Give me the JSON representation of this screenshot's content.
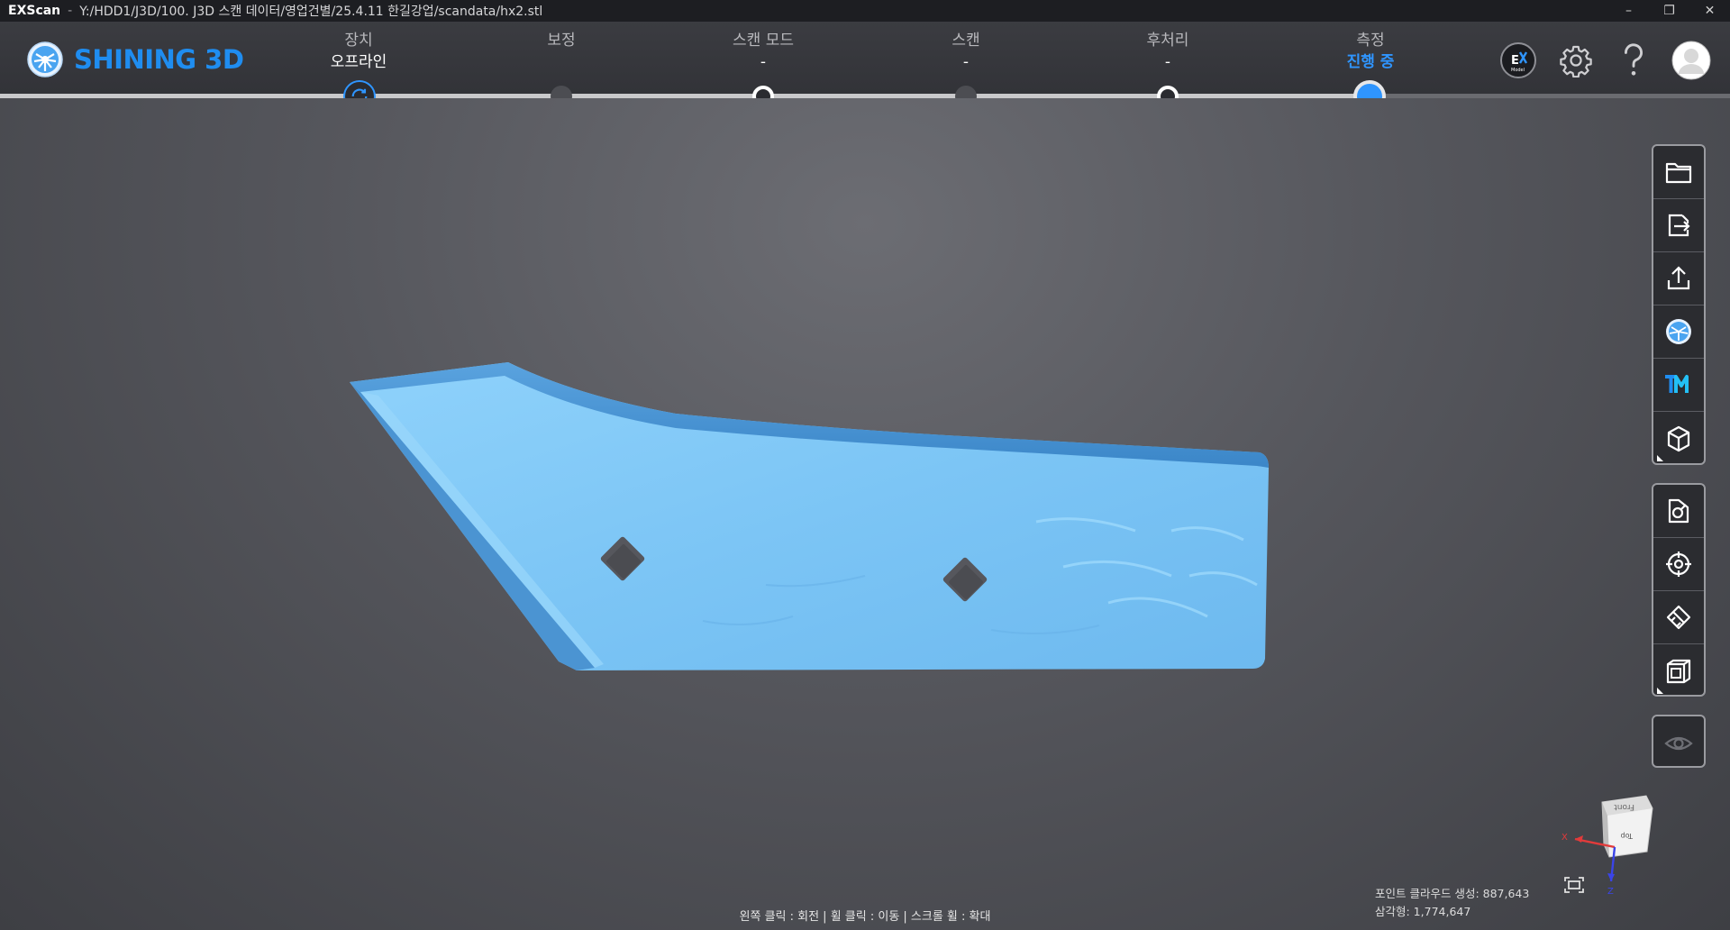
{
  "titlebar": {
    "app_name": "EXScan",
    "separator": "-",
    "file_path": "Y:/HDD1/J3D/100. J3D 스캔 데이터/영업건별/25.4.11 한길강업/scandata/hx2.stl",
    "minimize": "–",
    "restore": "❐",
    "close": "✕"
  },
  "header": {
    "logo_text": "SHINING 3D",
    "steps": [
      {
        "title": "장치",
        "status": "오프라인"
      },
      {
        "title": "보정",
        "status": ""
      },
      {
        "title": "스캔 모드",
        "status": "-"
      },
      {
        "title": "스캔",
        "status": "-"
      },
      {
        "title": "후처리",
        "status": "-"
      },
      {
        "title": "측정",
        "status": "진행 중"
      }
    ],
    "icons": [
      "ex-model-icon",
      "settings-gear-icon",
      "help-icon",
      "user-avatar-icon"
    ]
  },
  "colors": {
    "accent": "#1f8df0",
    "active_step": "#2f95ff",
    "model": "#7fc6f5"
  },
  "toolbar": {
    "group1": [
      "open-folder-icon",
      "export-icon",
      "upload-share-icon",
      "shining-app-icon",
      "tm-logo-icon",
      "3d-box-icon"
    ],
    "group2": [
      "object-select-icon",
      "target-crosshair-icon",
      "measure-tool-icon",
      "wireframe-cube-icon"
    ],
    "group3": [
      "visibility-eye-icon"
    ]
  },
  "hint": "왼쪽 클릭 : 회전 | 휠 클릭 : 이동 | 스크롤 휠 : 확대",
  "stats": {
    "points": "포인트 클라우드 생성: 887,643",
    "triangles": "삼각형: 1,774,647"
  },
  "view_cube": {
    "top_label": "Front",
    "front_label": "Top",
    "axis_x": "X",
    "axis_z": "Z"
  }
}
